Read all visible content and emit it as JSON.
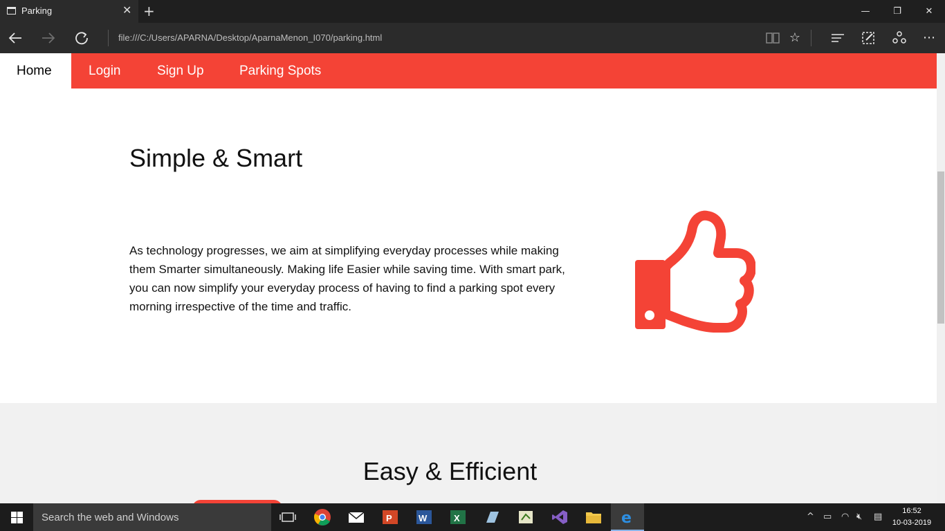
{
  "browser": {
    "tab_title": "Parking",
    "url": "file:///C:/Users/APARNA/Desktop/AparnaMenon_I070/parking.html",
    "icons": [
      "back-icon",
      "forward-icon",
      "refresh-icon",
      "reading-view-icon",
      "favorite-icon",
      "hub-icon",
      "web-note-icon",
      "share-icon",
      "more-icon"
    ]
  },
  "nav": {
    "items": [
      {
        "label": "Home",
        "active": true
      },
      {
        "label": "Login",
        "active": false
      },
      {
        "label": "Sign Up",
        "active": false
      },
      {
        "label": "Parking Spots",
        "active": false
      }
    ]
  },
  "section1": {
    "heading": "Simple & Smart",
    "paragraph": "As technology progresses, we aim at simplifying everyday processes while making them Smarter simultaneously. Making life Easier while saving time. With smart park, you can now simplify your everyday process of having to find a parking spot every morning irrespective of the time and traffic.",
    "icon": "thumbs-up-icon"
  },
  "section2": {
    "heading": "Easy & Efficient"
  },
  "taskbar": {
    "search_placeholder": "Search the web and Windows",
    "time": "16:52",
    "date": "10-03-2019"
  },
  "colors": {
    "accent": "#f44336",
    "section_alt_bg": "#f1f1f1"
  }
}
